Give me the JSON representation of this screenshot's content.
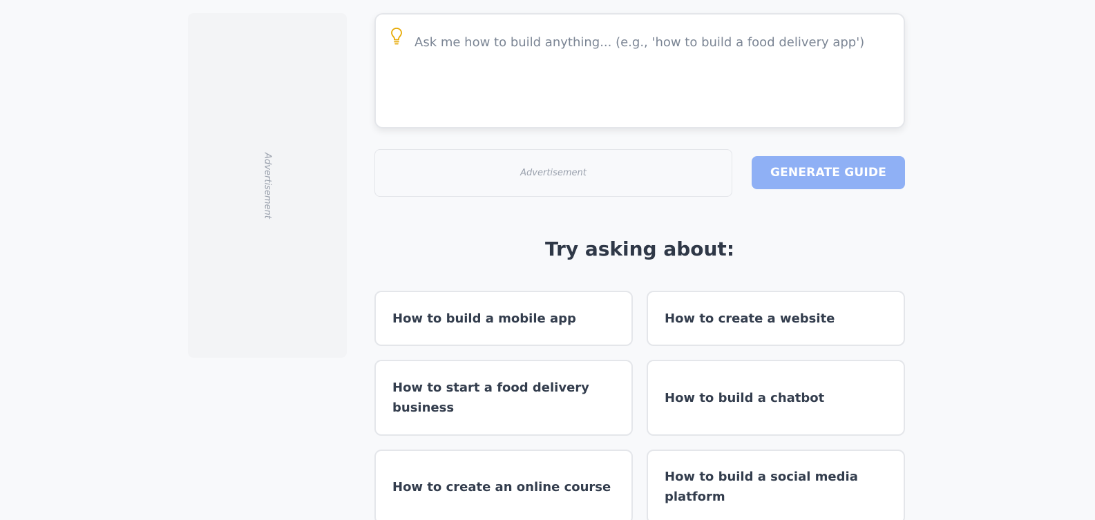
{
  "prompt": {
    "placeholder": "Ask me how to build anything... (e.g., 'how to build a food delivery app')",
    "value": ""
  },
  "ads": {
    "side_label": "Advertisement",
    "inline_label": "Advertisement"
  },
  "generate_button": {
    "label": "GENERATE GUIDE",
    "color": "#8fb0f5"
  },
  "suggestions_section": {
    "title": "Try asking about:",
    "items": [
      {
        "label": "How to build a mobile app"
      },
      {
        "label": "How to create a website"
      },
      {
        "label": "How to start a food delivery business"
      },
      {
        "label": "How to build a chatbot"
      },
      {
        "label": "How to create an online course"
      },
      {
        "label": "How to build a social media platform"
      }
    ]
  },
  "icons": {
    "prompt_icon": "lightbulb-icon",
    "prompt_icon_color": "#e6a800"
  }
}
